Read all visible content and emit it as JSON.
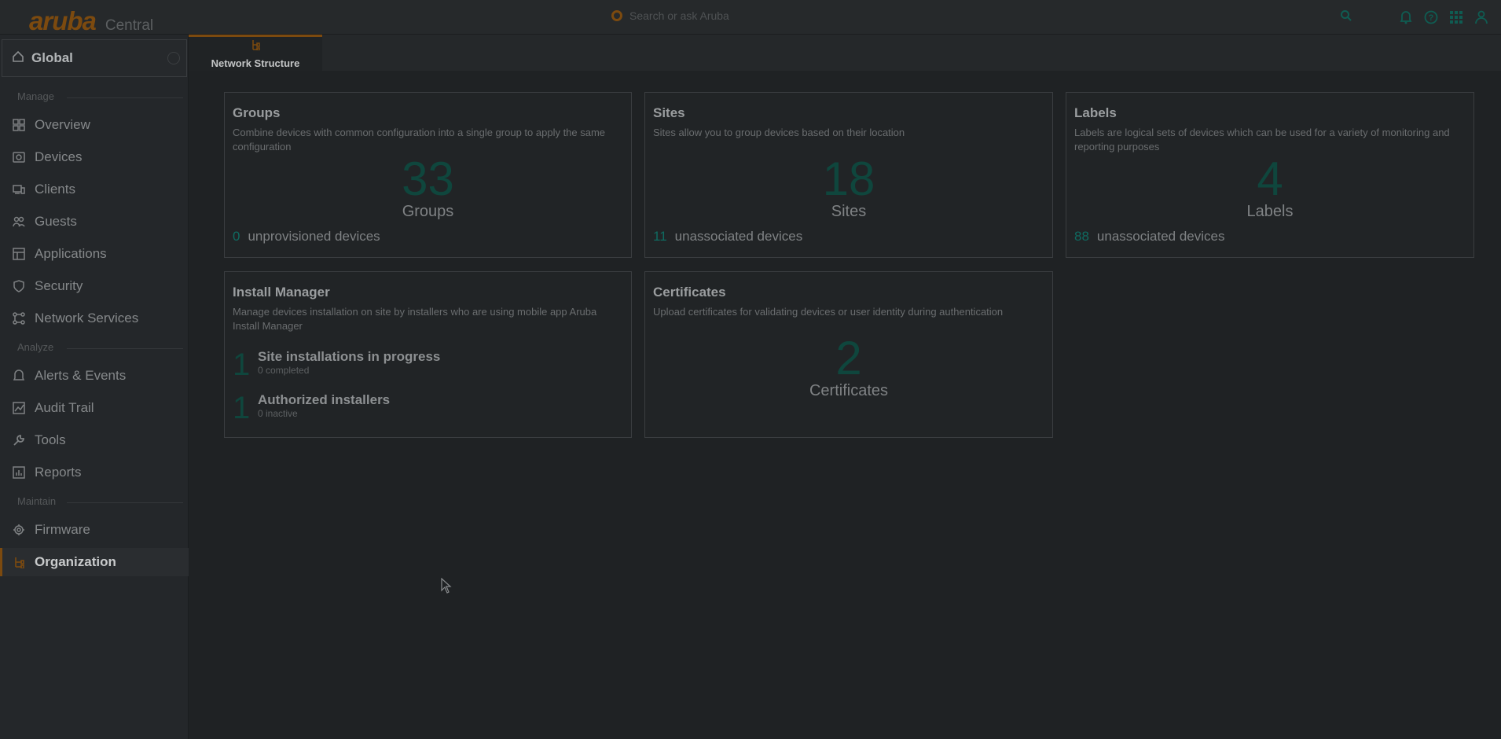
{
  "header": {
    "logo_word": "aruba",
    "logo_sub": "Central",
    "search_placeholder": "Search or ask Aruba",
    "icons": [
      "search-icon",
      "bell-icon",
      "help-icon",
      "apps-grid-icon",
      "user-icon"
    ]
  },
  "sidebar": {
    "scope_label": "Global",
    "sections": {
      "manage": "Manage",
      "analyze": "Analyze",
      "maintain": "Maintain"
    },
    "items": [
      {
        "label": "Overview",
        "icon": "dashboard-icon"
      },
      {
        "label": "Devices",
        "icon": "devices-icon"
      },
      {
        "label": "Clients",
        "icon": "clients-icon"
      },
      {
        "label": "Guests",
        "icon": "guests-icon"
      },
      {
        "label": "Applications",
        "icon": "applications-icon"
      },
      {
        "label": "Security",
        "icon": "shield-icon"
      },
      {
        "label": "Network Services",
        "icon": "network-services-icon"
      },
      {
        "label": "Alerts & Events",
        "icon": "bell-icon"
      },
      {
        "label": "Audit Trail",
        "icon": "audit-icon"
      },
      {
        "label": "Tools",
        "icon": "wrench-icon"
      },
      {
        "label": "Reports",
        "icon": "reports-icon"
      },
      {
        "label": "Firmware",
        "icon": "firmware-icon"
      },
      {
        "label": "Organization",
        "icon": "organization-icon",
        "active": true
      }
    ]
  },
  "tabs": [
    {
      "label": "Network Structure",
      "icon": "organization-icon",
      "active": true
    }
  ],
  "cards": {
    "groups": {
      "title": "Groups",
      "desc": "Combine devices with common configuration into a single group to apply the same configuration",
      "value": "33",
      "value_label": "Groups",
      "foot_num": "0",
      "foot_text": "unprovisioned devices"
    },
    "sites": {
      "title": "Sites",
      "desc": "Sites allow you to group devices based on their location",
      "value": "18",
      "value_label": "Sites",
      "foot_num": "11",
      "foot_text": "unassociated devices"
    },
    "labels": {
      "title": "Labels",
      "desc": "Labels are logical sets of devices which can be used for a variety of monitoring and reporting purposes",
      "value": "4",
      "value_label": "Labels",
      "foot_num": "88",
      "foot_text": "unassociated devices"
    },
    "install": {
      "title": "Install Manager",
      "desc": "Manage devices installation on site by installers who are using mobile app Aruba Install Manager",
      "rows": [
        {
          "num": "1",
          "title": "Site installations in progress",
          "sub": "0 completed"
        },
        {
          "num": "1",
          "title": "Authorized installers",
          "sub": "0 inactive"
        }
      ]
    },
    "certificates": {
      "title": "Certificates",
      "desc": "Upload certificates for validating devices or user identity during authentication",
      "value": "2",
      "value_label": "Certificates"
    }
  },
  "colors": {
    "accent": "#ff8300",
    "teal": "#01a982",
    "overlay": "#000000"
  }
}
